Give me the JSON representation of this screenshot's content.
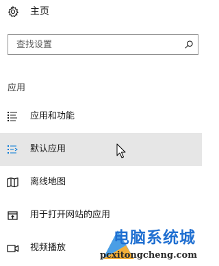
{
  "home": {
    "icon": "gear-icon",
    "label": "主页"
  },
  "search": {
    "value": "",
    "placeholder": "查找设置",
    "icon": "search-icon"
  },
  "section": {
    "title": "应用"
  },
  "nav": {
    "items": [
      {
        "label": "应用和功能",
        "icon": "apps-list-icon",
        "selected": false
      },
      {
        "label": "默认应用",
        "icon": "default-apps-icon",
        "selected": true
      },
      {
        "label": "离线地图",
        "icon": "offline-map-icon",
        "selected": false
      },
      {
        "label": "用于打开网站的应用",
        "icon": "open-website-icon",
        "selected": false
      },
      {
        "label": "视频播放",
        "icon": "video-playback-icon",
        "selected": false
      }
    ]
  },
  "colors": {
    "accent": "#0078d7",
    "selected_background": "#e6e6e6",
    "watermark_blue": "#1f6fd1"
  },
  "watermark": {
    "title": "电脑系统城",
    "url": "pcxitongcheng.com"
  }
}
